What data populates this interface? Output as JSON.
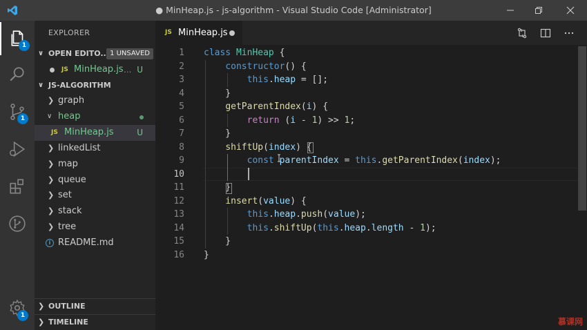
{
  "window": {
    "title": "● MinHeap.js - js-algorithm - Visual Studio Code [Administrator]"
  },
  "activity": {
    "explorer_badge": "1",
    "scm_badge": "1",
    "settings_badge": "1"
  },
  "sidebar": {
    "title": "EXPLORER",
    "open_editors": {
      "label": "OPEN EDITO...",
      "badge": "1 UNSAVED",
      "items": [
        {
          "icon": "JS",
          "name": "MinHeap.js",
          "ellipsis": "...",
          "status": "U"
        }
      ]
    },
    "project": {
      "label": "JS-ALGORITHM",
      "items": [
        {
          "name": "graph"
        },
        {
          "name": "heap"
        },
        {
          "icon": "JS",
          "name": "MinHeap.js",
          "status": "U"
        },
        {
          "name": "linkedList"
        },
        {
          "name": "map"
        },
        {
          "name": "queue"
        },
        {
          "name": "set"
        },
        {
          "name": "stack"
        },
        {
          "name": "tree"
        },
        {
          "name": "README.md"
        }
      ]
    },
    "outline_label": "OUTLINE",
    "timeline_label": "TIMELINE"
  },
  "tabs": [
    {
      "icon": "JS",
      "label": "MinHeap.js"
    }
  ],
  "editor": {
    "line_numbers": [
      "1",
      "2",
      "3",
      "4",
      "5",
      "6",
      "7",
      "8",
      "9",
      "10",
      "11",
      "12",
      "13",
      "14",
      "15",
      "16"
    ],
    "current_line": 10
  },
  "watermark": "慕课网"
}
